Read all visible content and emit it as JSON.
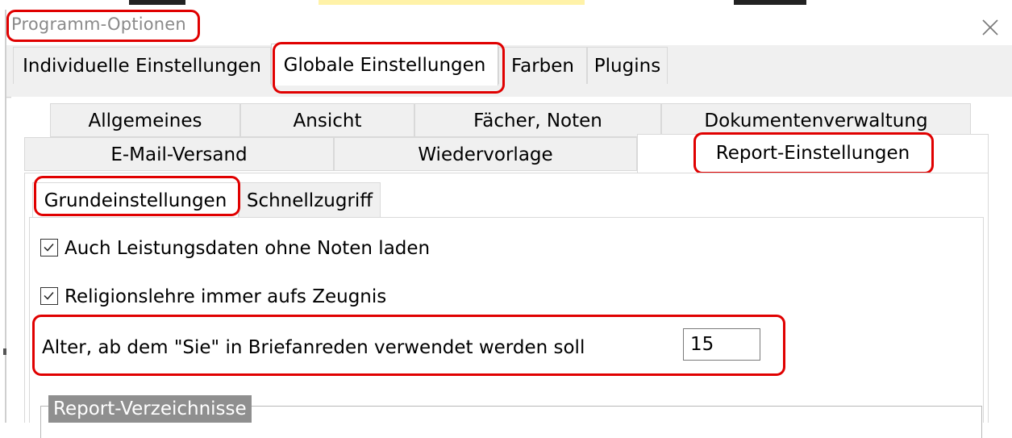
{
  "window": {
    "title": "Programm-Optionen",
    "close_icon": "close-icon"
  },
  "top_tabs": [
    {
      "label": "Individuelle Einstellungen",
      "active": false
    },
    {
      "label": "Globale Einstellungen",
      "active": true
    },
    {
      "label": "Farben",
      "active": false
    },
    {
      "label": "Plugins",
      "active": false
    }
  ],
  "sub_tabs_row1": [
    {
      "label": "Allgemeines"
    },
    {
      "label": "Ansicht"
    },
    {
      "label": "Fächer, Noten"
    },
    {
      "label": "Dokumentenverwaltung"
    }
  ],
  "sub_tabs_row2": [
    {
      "label": "E-Mail-Versand",
      "active": false
    },
    {
      "label": "Wiedervorlage",
      "active": false
    },
    {
      "label": "Report-Einstellungen",
      "active": true
    }
  ],
  "inner_tabs": [
    {
      "label": "Grundeinstellungen",
      "active": true
    },
    {
      "label": "Schnellzugriff",
      "active": false
    }
  ],
  "options": {
    "load_without_grades": {
      "label": "Auch Leistungsdaten ohne Noten laden",
      "checked": true
    },
    "religion_always": {
      "label": "Religionslehre immer aufs Zeugnis",
      "checked": true
    },
    "formal_age": {
      "label": "Alter, ab dem \"Sie\" in Briefanreden verwendet werden soll",
      "value": "15"
    }
  },
  "report_dirs": {
    "title": "Report-Verzeichnisse"
  },
  "colors": {
    "highlight": "#e00000"
  }
}
